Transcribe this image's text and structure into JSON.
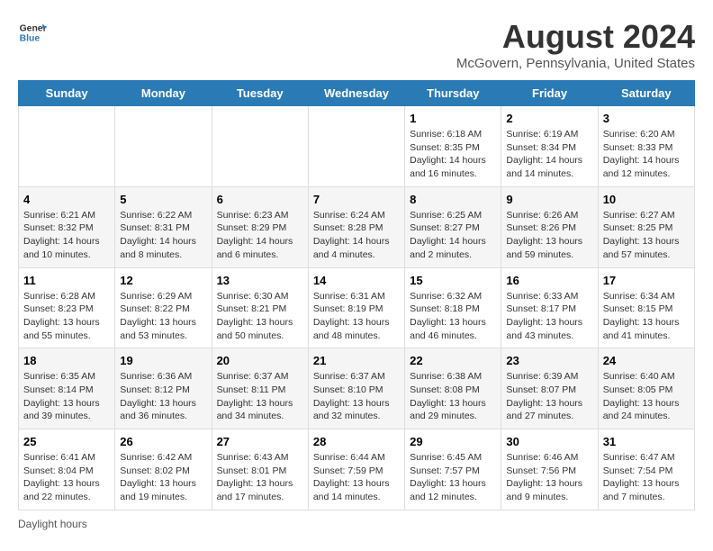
{
  "logo": {
    "line1": "General",
    "line2": "Blue"
  },
  "title": "August 2024",
  "subtitle": "McGovern, Pennsylvania, United States",
  "days_header": [
    "Sunday",
    "Monday",
    "Tuesday",
    "Wednesday",
    "Thursday",
    "Friday",
    "Saturday"
  ],
  "footer": "Daylight hours",
  "weeks": [
    [
      {
        "day": "",
        "info": ""
      },
      {
        "day": "",
        "info": ""
      },
      {
        "day": "",
        "info": ""
      },
      {
        "day": "",
        "info": ""
      },
      {
        "day": "1",
        "info": "Sunrise: 6:18 AM\nSunset: 8:35 PM\nDaylight: 14 hours and 16 minutes."
      },
      {
        "day": "2",
        "info": "Sunrise: 6:19 AM\nSunset: 8:34 PM\nDaylight: 14 hours and 14 minutes."
      },
      {
        "day": "3",
        "info": "Sunrise: 6:20 AM\nSunset: 8:33 PM\nDaylight: 14 hours and 12 minutes."
      }
    ],
    [
      {
        "day": "4",
        "info": "Sunrise: 6:21 AM\nSunset: 8:32 PM\nDaylight: 14 hours and 10 minutes."
      },
      {
        "day": "5",
        "info": "Sunrise: 6:22 AM\nSunset: 8:31 PM\nDaylight: 14 hours and 8 minutes."
      },
      {
        "day": "6",
        "info": "Sunrise: 6:23 AM\nSunset: 8:29 PM\nDaylight: 14 hours and 6 minutes."
      },
      {
        "day": "7",
        "info": "Sunrise: 6:24 AM\nSunset: 8:28 PM\nDaylight: 14 hours and 4 minutes."
      },
      {
        "day": "8",
        "info": "Sunrise: 6:25 AM\nSunset: 8:27 PM\nDaylight: 14 hours and 2 minutes."
      },
      {
        "day": "9",
        "info": "Sunrise: 6:26 AM\nSunset: 8:26 PM\nDaylight: 13 hours and 59 minutes."
      },
      {
        "day": "10",
        "info": "Sunrise: 6:27 AM\nSunset: 8:25 PM\nDaylight: 13 hours and 57 minutes."
      }
    ],
    [
      {
        "day": "11",
        "info": "Sunrise: 6:28 AM\nSunset: 8:23 PM\nDaylight: 13 hours and 55 minutes."
      },
      {
        "day": "12",
        "info": "Sunrise: 6:29 AM\nSunset: 8:22 PM\nDaylight: 13 hours and 53 minutes."
      },
      {
        "day": "13",
        "info": "Sunrise: 6:30 AM\nSunset: 8:21 PM\nDaylight: 13 hours and 50 minutes."
      },
      {
        "day": "14",
        "info": "Sunrise: 6:31 AM\nSunset: 8:19 PM\nDaylight: 13 hours and 48 minutes."
      },
      {
        "day": "15",
        "info": "Sunrise: 6:32 AM\nSunset: 8:18 PM\nDaylight: 13 hours and 46 minutes."
      },
      {
        "day": "16",
        "info": "Sunrise: 6:33 AM\nSunset: 8:17 PM\nDaylight: 13 hours and 43 minutes."
      },
      {
        "day": "17",
        "info": "Sunrise: 6:34 AM\nSunset: 8:15 PM\nDaylight: 13 hours and 41 minutes."
      }
    ],
    [
      {
        "day": "18",
        "info": "Sunrise: 6:35 AM\nSunset: 8:14 PM\nDaylight: 13 hours and 39 minutes."
      },
      {
        "day": "19",
        "info": "Sunrise: 6:36 AM\nSunset: 8:12 PM\nDaylight: 13 hours and 36 minutes."
      },
      {
        "day": "20",
        "info": "Sunrise: 6:37 AM\nSunset: 8:11 PM\nDaylight: 13 hours and 34 minutes."
      },
      {
        "day": "21",
        "info": "Sunrise: 6:37 AM\nSunset: 8:10 PM\nDaylight: 13 hours and 32 minutes."
      },
      {
        "day": "22",
        "info": "Sunrise: 6:38 AM\nSunset: 8:08 PM\nDaylight: 13 hours and 29 minutes."
      },
      {
        "day": "23",
        "info": "Sunrise: 6:39 AM\nSunset: 8:07 PM\nDaylight: 13 hours and 27 minutes."
      },
      {
        "day": "24",
        "info": "Sunrise: 6:40 AM\nSunset: 8:05 PM\nDaylight: 13 hours and 24 minutes."
      }
    ],
    [
      {
        "day": "25",
        "info": "Sunrise: 6:41 AM\nSunset: 8:04 PM\nDaylight: 13 hours and 22 minutes."
      },
      {
        "day": "26",
        "info": "Sunrise: 6:42 AM\nSunset: 8:02 PM\nDaylight: 13 hours and 19 minutes."
      },
      {
        "day": "27",
        "info": "Sunrise: 6:43 AM\nSunset: 8:01 PM\nDaylight: 13 hours and 17 minutes."
      },
      {
        "day": "28",
        "info": "Sunrise: 6:44 AM\nSunset: 7:59 PM\nDaylight: 13 hours and 14 minutes."
      },
      {
        "day": "29",
        "info": "Sunrise: 6:45 AM\nSunset: 7:57 PM\nDaylight: 13 hours and 12 minutes."
      },
      {
        "day": "30",
        "info": "Sunrise: 6:46 AM\nSunset: 7:56 PM\nDaylight: 13 hours and 9 minutes."
      },
      {
        "day": "31",
        "info": "Sunrise: 6:47 AM\nSunset: 7:54 PM\nDaylight: 13 hours and 7 minutes."
      }
    ]
  ]
}
